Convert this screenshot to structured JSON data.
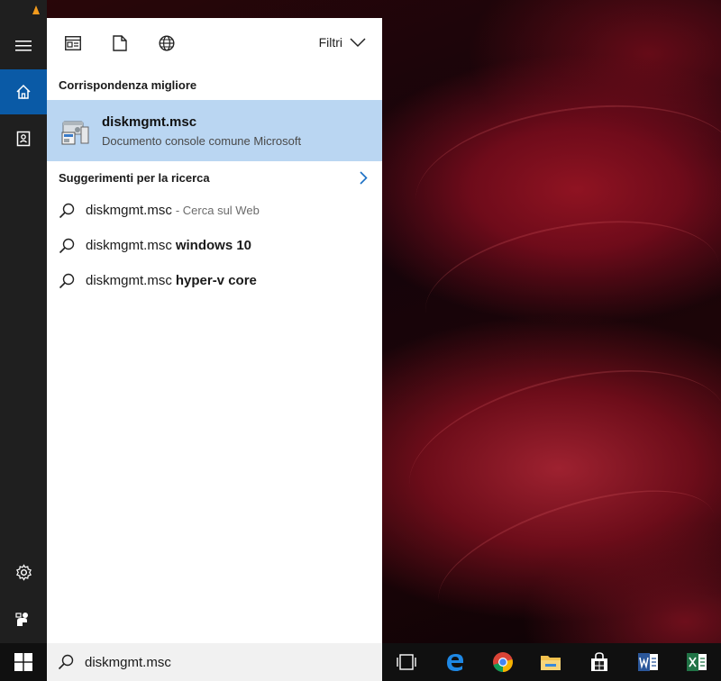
{
  "panel": {
    "filters_label": "Filtri",
    "best_match_header": "Corrispondenza migliore",
    "best_match": {
      "title": "diskmgmt.msc",
      "subtitle": "Documento console comune Microsoft"
    },
    "suggestions_header": "Suggerimenti per la ricerca",
    "suggestions": [
      {
        "query": "diskmgmt.msc",
        "extra": "- Cerca sul Web",
        "extra_style": "hint"
      },
      {
        "query": "diskmgmt.msc",
        "extra": "windows 10",
        "extra_style": "bold"
      },
      {
        "query": "diskmgmt.msc",
        "extra": "hyper-v core",
        "extra_style": "bold"
      }
    ]
  },
  "search": {
    "value": "diskmgmt.msc"
  },
  "rail": {
    "items": [
      "hamburger-icon",
      "home-icon",
      "notebook-icon",
      "settings-icon",
      "feedback-icon"
    ],
    "active": "home-icon"
  },
  "taskbar": {
    "icons": [
      "task-view-icon",
      "edge-icon",
      "chrome-icon",
      "file-explorer-icon",
      "store-icon",
      "word-icon",
      "excel-icon"
    ]
  },
  "colors": {
    "accent": "#0a5aa6",
    "best_match_bg": "#bad6f2",
    "taskbar_bg": "#101010",
    "rail_bg": "#1f1f1f"
  }
}
